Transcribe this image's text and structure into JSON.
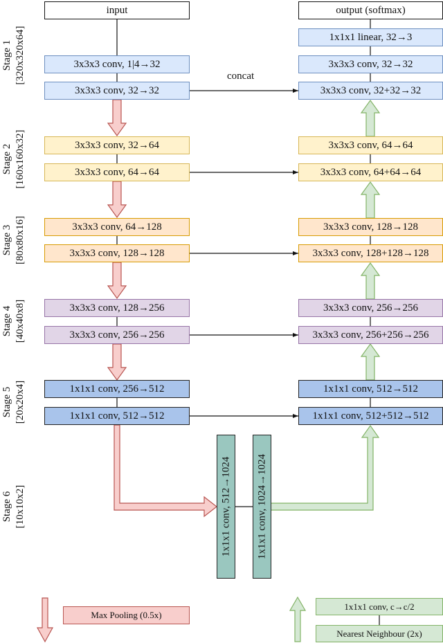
{
  "io": {
    "input": "input",
    "output": "output (softmax)"
  },
  "concat_label": "concat",
  "stages": [
    {
      "name": "Stage 1",
      "dims": "[320x320x64]"
    },
    {
      "name": "Stage 2",
      "dims": "[160x160x32]"
    },
    {
      "name": "Stage 3",
      "dims": "[80x80x16]"
    },
    {
      "name": "Stage 4",
      "dims": "[40x40x8]"
    },
    {
      "name": "Stage 5",
      "dims": "[20x20x4]"
    },
    {
      "name": "Stage 6",
      "dims": "[10x10x2]"
    }
  ],
  "encoder": {
    "stage1": [
      "3x3x3 conv, 1|4→32",
      "3x3x3 conv, 32→32"
    ],
    "stage2": [
      "3x3x3 conv, 32→64",
      "3x3x3 conv, 64→64"
    ],
    "stage3": [
      "3x3x3 conv, 64→128",
      "3x3x3 conv, 128→128"
    ],
    "stage4": [
      "3x3x3 conv, 128→256",
      "3x3x3 conv, 256→256"
    ],
    "stage5": [
      "1x1x1 conv, 256→512",
      "1x1x1 conv, 512→512"
    ]
  },
  "decoder": {
    "final": "1x1x1 linear, 32→3",
    "stage1": [
      "3x3x3 conv, 32→32",
      "3x3x3 conv, 32+32→32"
    ],
    "stage2": [
      "3x3x3 conv, 64→64",
      "3x3x3 conv, 64+64→64"
    ],
    "stage3": [
      "3x3x3 conv, 128→128",
      "3x3x3 conv, 128+128→128"
    ],
    "stage4": [
      "3x3x3 conv, 256→256",
      "3x3x3 conv, 256+256→256"
    ],
    "stage5": [
      "1x1x1 conv, 512→512",
      "1x1x1 conv, 512+512→512"
    ]
  },
  "bottleneck": [
    "1x1x1 conv, 512→1024",
    "1x1x1 conv, 1024→1024"
  ],
  "legend": {
    "downsample": "Max Pooling (0.5x)",
    "upsample": [
      "1x1x1 conv, c→c/2",
      "Nearest Neighbour (2x)"
    ]
  },
  "colors": {
    "stage1_fill": "#dae8fc",
    "stage2_fill": "#fff2cc",
    "stage3_fill": "#ffe6cc",
    "stage4_fill": "#e1d5e7",
    "stage5_fill": "#a9c4eb",
    "stage6_fill": "#9ac7bf",
    "pool_arrow": "#f8cecc",
    "upsample_arrow": "#d5e8d4"
  }
}
